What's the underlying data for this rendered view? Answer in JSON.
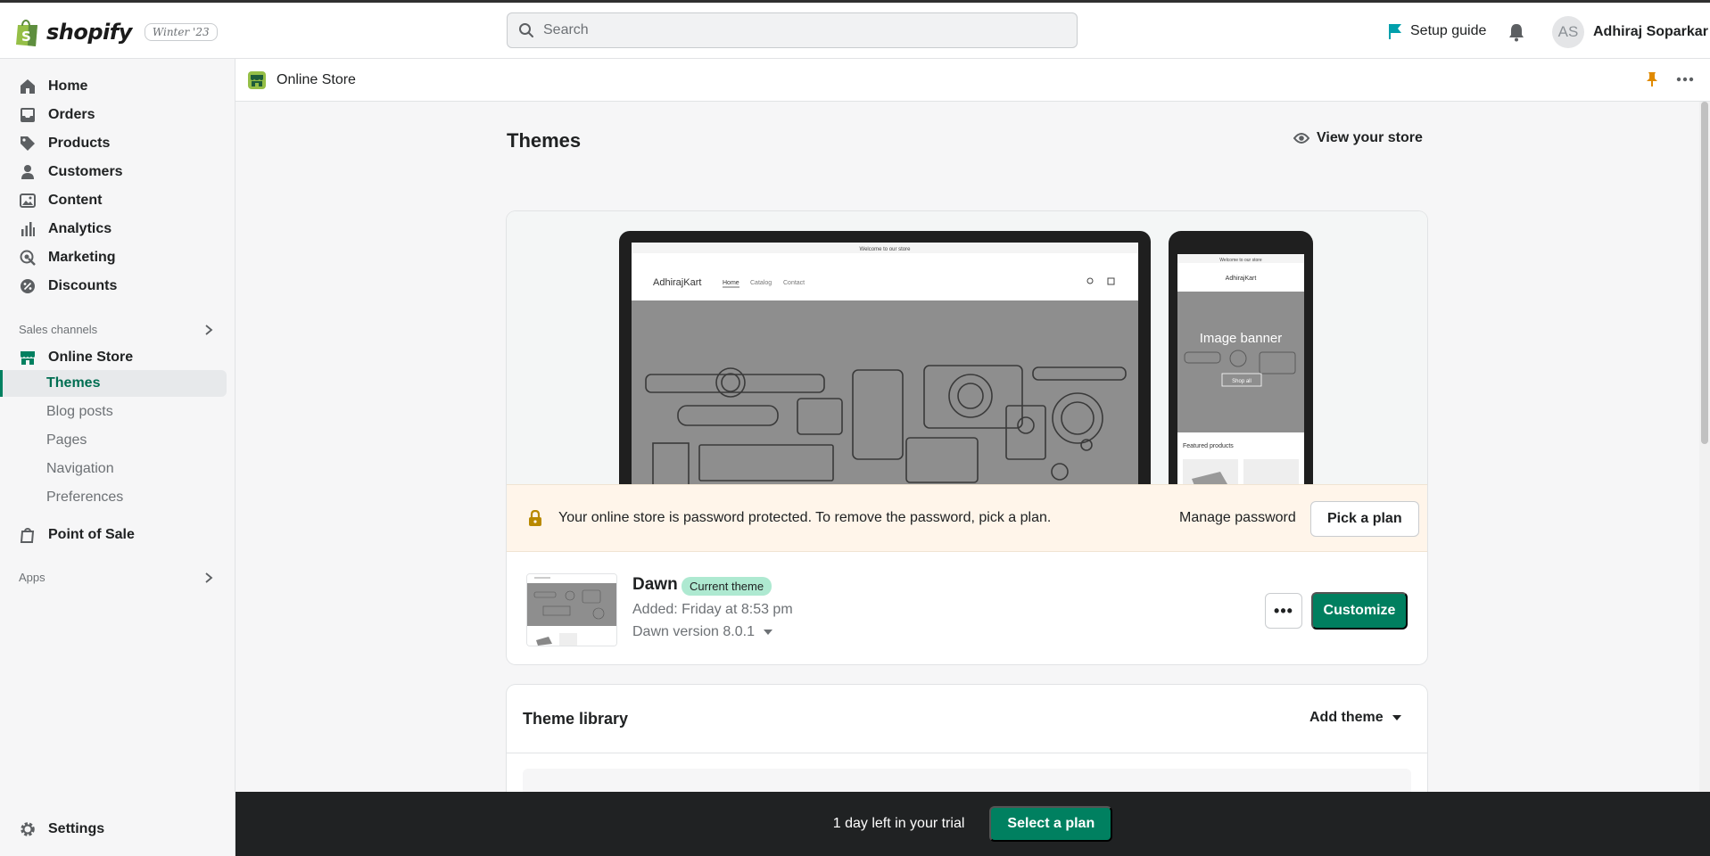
{
  "brand": {
    "logo_text": "shopify",
    "version_badge": "Winter '23",
    "accent": "#008060"
  },
  "search": {
    "placeholder": "Search"
  },
  "topbar": {
    "setup_guide": "Setup guide",
    "user_initials": "AS",
    "user_name": "Adhiraj Soparkar"
  },
  "sidebar": {
    "items": [
      {
        "label": "Home",
        "icon": "home-icon"
      },
      {
        "label": "Orders",
        "icon": "inbox-icon"
      },
      {
        "label": "Products",
        "icon": "tag-icon"
      },
      {
        "label": "Customers",
        "icon": "person-icon"
      },
      {
        "label": "Content",
        "icon": "image-icon"
      },
      {
        "label": "Analytics",
        "icon": "bar-chart-icon"
      },
      {
        "label": "Marketing",
        "icon": "target-icon"
      },
      {
        "label": "Discounts",
        "icon": "discount-icon"
      }
    ],
    "sales_channels_label": "Sales channels",
    "online_store": "Online Store",
    "online_store_sub": [
      "Themes",
      "Blog posts",
      "Pages",
      "Navigation",
      "Preferences"
    ],
    "point_of_sale": "Point of Sale",
    "apps_label": "Apps",
    "settings": "Settings"
  },
  "content_header": {
    "title": "Online Store"
  },
  "main": {
    "page_title": "Themes",
    "view_store": "View your store",
    "preview": {
      "store_name": "AdhirajKart",
      "welcome": "Welcome to our store",
      "nav_links": [
        "Home",
        "Catalog",
        "Contact"
      ],
      "mobile_banner_title": "Image banner",
      "mobile_banner_button": "Shop all",
      "featured": "Featured products"
    },
    "password_banner": {
      "message": "Your online store is password protected. To remove the password, pick a plan.",
      "manage": "Manage password",
      "pick_plan": "Pick a plan"
    },
    "current_theme": {
      "name": "Dawn",
      "badge": "Current theme",
      "added": "Added: Friday at 8:53 pm",
      "version": "Dawn version 8.0.1",
      "more": "•••",
      "customize": "Customize"
    },
    "library": {
      "title": "Theme library",
      "add_theme": "Add theme"
    }
  },
  "trial": {
    "text": "1 day left in your trial",
    "button": "Select a plan"
  }
}
